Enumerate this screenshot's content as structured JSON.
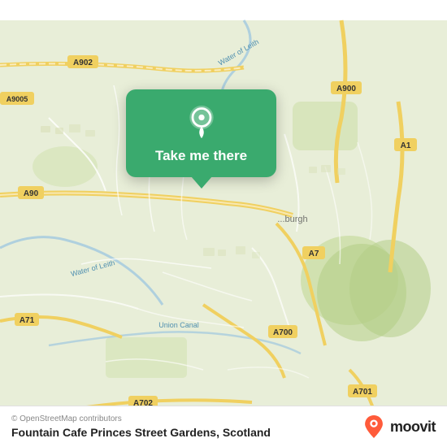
{
  "map": {
    "alt": "OpenStreetMap of Edinburgh, Scotland",
    "copyright": "© OpenStreetMap contributors",
    "background_color": "#e8f0d8",
    "road_color": "#ffffff",
    "highlight_color": "#f0f4d8"
  },
  "popup": {
    "label": "Take me there",
    "background_color": "#3aaa6e",
    "icon": "location-pin-icon"
  },
  "bottom_bar": {
    "copyright": "© OpenStreetMap contributors",
    "location_name": "Fountain Cafe Princes Street Gardens, Scotland"
  },
  "moovit": {
    "brand_name": "moovit",
    "pin_color_top": "#ff5b3a",
    "pin_color_bottom": "#d93d1a"
  },
  "road_labels": {
    "a902": "A902",
    "a900": "A900",
    "a90": "A90",
    "a1": "A1",
    "a7": "A7",
    "a71": "A71",
    "a700": "A700",
    "a702": "A702",
    "a701": "A701",
    "a9005": "A9005",
    "water_of_leith": "Water of Leith",
    "union_canal": "Union Canal"
  }
}
